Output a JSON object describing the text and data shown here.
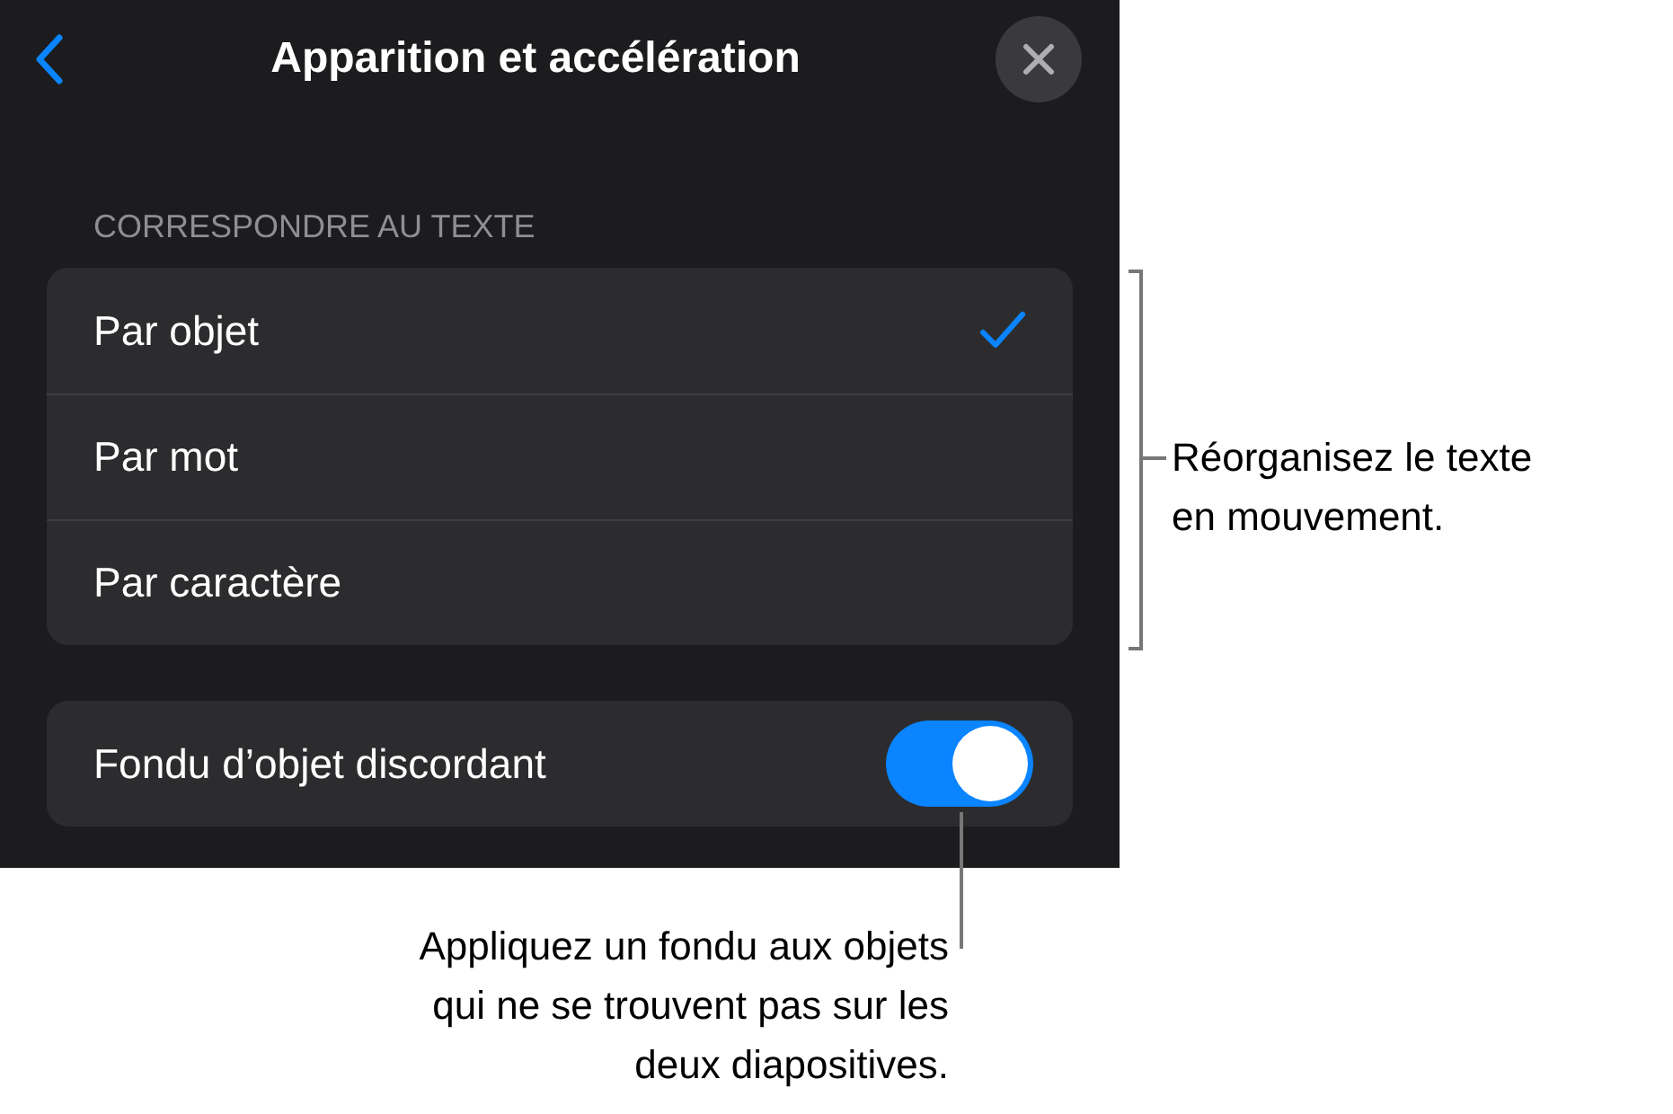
{
  "header": {
    "title": "Apparition et accélération"
  },
  "section": {
    "label": "CORRESPONDRE AU TEXTE",
    "options": [
      {
        "label": "Par objet",
        "selected": true
      },
      {
        "label": "Par mot",
        "selected": false
      },
      {
        "label": "Par caractère",
        "selected": false
      }
    ]
  },
  "toggle_row": {
    "label": "Fondu d’objet discordant",
    "on": true
  },
  "callouts": [
    {
      "kind": "bracket",
      "lines": [
        "Réorganisez le texte",
        "en mouvement."
      ]
    },
    {
      "kind": "pointer",
      "lines": [
        "Appliquez un fondu aux objets",
        "qui ne se trouvent pas sur les",
        "deux diapositives."
      ]
    }
  ]
}
